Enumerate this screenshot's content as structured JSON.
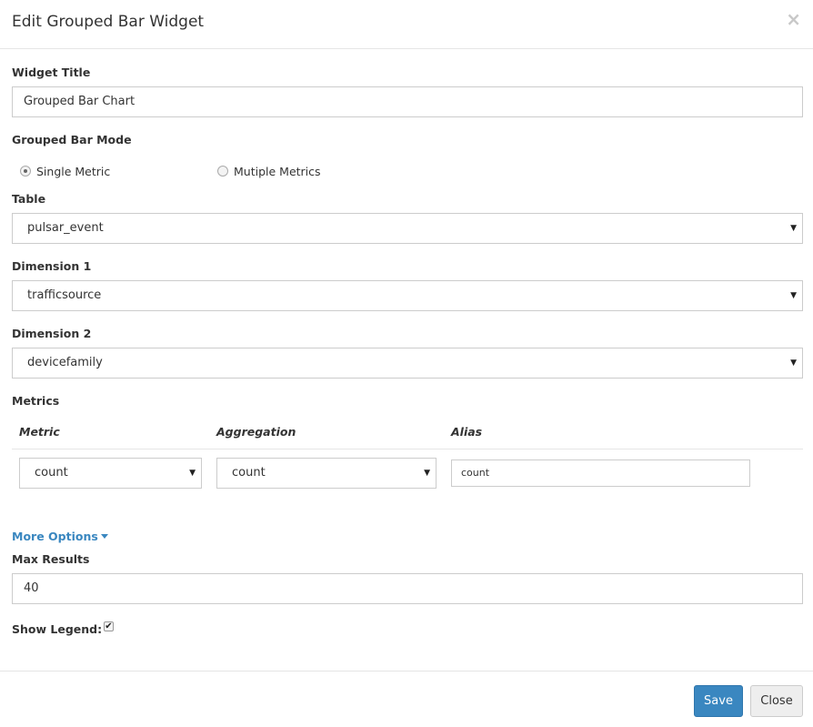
{
  "modal": {
    "title": "Edit Grouped Bar Widget",
    "close_icon": "×"
  },
  "widget_title": {
    "label": "Widget Title",
    "value": "Grouped Bar Chart"
  },
  "mode": {
    "label": "Grouped Bar Mode",
    "options": [
      {
        "label": "Single Metric",
        "checked": true
      },
      {
        "label": "Mutiple Metrics",
        "checked": false
      }
    ]
  },
  "table": {
    "label": "Table",
    "selected": "pulsar_event"
  },
  "dimension1": {
    "label": "Dimension 1",
    "selected": "trafficsource"
  },
  "dimension2": {
    "label": "Dimension 2",
    "selected": "devicefamily"
  },
  "metrics": {
    "label": "Metrics",
    "headers": [
      "Metric",
      "Aggregation",
      "Alias"
    ],
    "rows": [
      {
        "metric": "count",
        "aggregation": "count",
        "alias": "count"
      }
    ]
  },
  "more_options": {
    "label": "More Options"
  },
  "max_results": {
    "label": "Max Results",
    "value": "40"
  },
  "show_legend": {
    "label": "Show Legend:",
    "checked": true
  },
  "footer": {
    "save_label": "Save",
    "close_label": "Close"
  }
}
